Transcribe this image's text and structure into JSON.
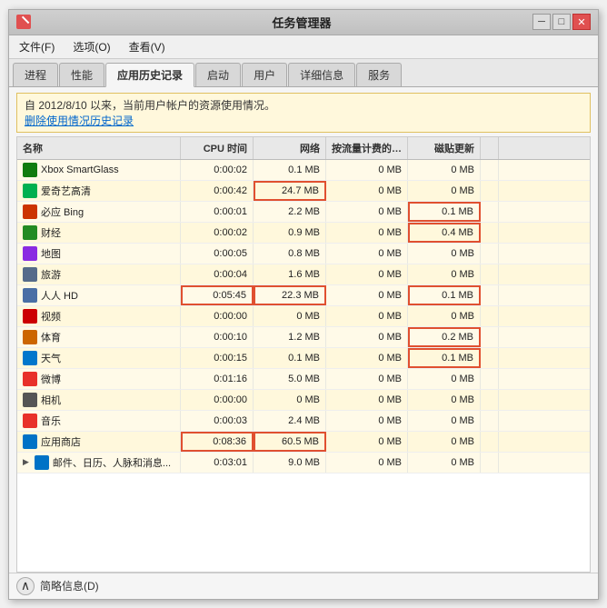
{
  "window": {
    "title": "任务管理器",
    "controls": {
      "minimize": "─",
      "maximize": "□",
      "close": "✕"
    }
  },
  "menu": {
    "items": [
      {
        "label": "文件(F)"
      },
      {
        "label": "选项(O)"
      },
      {
        "label": "查看(V)"
      }
    ]
  },
  "tabs": [
    {
      "label": "进程",
      "active": false
    },
    {
      "label": "性能",
      "active": false
    },
    {
      "label": "应用历史记录",
      "active": true
    },
    {
      "label": "启动",
      "active": false
    },
    {
      "label": "用户",
      "active": false
    },
    {
      "label": "详细信息",
      "active": false
    },
    {
      "label": "服务",
      "active": false
    }
  ],
  "info": {
    "text": "自 2012/8/10 以来，当前用户帐户的资源使用情况。",
    "link": "删除使用情况历史记录"
  },
  "table": {
    "headers": [
      "名称",
      "CPU 时间",
      "网络",
      "按流量计费的网...",
      "磁贴更新"
    ],
    "rows": [
      {
        "name": "Xbox SmartGlass",
        "cpu": "0:00:02",
        "network": "0.1 MB",
        "metered": "0 MB",
        "tile": "0 MB",
        "iconColor": "#107C10",
        "highlight_cpu": false,
        "highlight_net": false,
        "highlight_tile": false
      },
      {
        "name": "爱奇艺高清",
        "cpu": "0:00:42",
        "network": "24.7 MB",
        "metered": "0 MB",
        "tile": "0 MB",
        "iconColor": "#00b050",
        "highlight_cpu": false,
        "highlight_net": true,
        "highlight_tile": false
      },
      {
        "name": "必应 Bing",
        "cpu": "0:00:01",
        "network": "2.2 MB",
        "metered": "0 MB",
        "tile": "0.1 MB",
        "iconColor": "#cc3300",
        "highlight_cpu": false,
        "highlight_net": false,
        "highlight_tile": true
      },
      {
        "name": "财经",
        "cpu": "0:00:02",
        "network": "0.9 MB",
        "metered": "0 MB",
        "tile": "0.4 MB",
        "iconColor": "#228B22",
        "highlight_cpu": false,
        "highlight_net": false,
        "highlight_tile": true
      },
      {
        "name": "地图",
        "cpu": "0:00:05",
        "network": "0.8 MB",
        "metered": "0 MB",
        "tile": "0 MB",
        "iconColor": "#8a2be2",
        "highlight_cpu": false,
        "highlight_net": false,
        "highlight_tile": false
      },
      {
        "name": "旅游",
        "cpu": "0:00:04",
        "network": "1.6 MB",
        "metered": "0 MB",
        "tile": "0 MB",
        "iconColor": "#556b8a",
        "highlight_cpu": false,
        "highlight_net": false,
        "highlight_tile": false
      },
      {
        "name": "人人 HD",
        "cpu": "0:05:45",
        "network": "22.3 MB",
        "metered": "0 MB",
        "tile": "0.1 MB",
        "iconColor": "#4a6fa5",
        "highlight_cpu": true,
        "highlight_net": true,
        "highlight_tile": true
      },
      {
        "name": "视频",
        "cpu": "0:00:00",
        "network": "0 MB",
        "metered": "0 MB",
        "tile": "0 MB",
        "iconColor": "#cc0000",
        "highlight_cpu": false,
        "highlight_net": false,
        "highlight_tile": false
      },
      {
        "name": "体育",
        "cpu": "0:00:10",
        "network": "1.2 MB",
        "metered": "0 MB",
        "tile": "0.2 MB",
        "iconColor": "#cc6600",
        "highlight_cpu": false,
        "highlight_net": false,
        "highlight_tile": true
      },
      {
        "name": "天气",
        "cpu": "0:00:15",
        "network": "0.1 MB",
        "metered": "0 MB",
        "tile": "0.1 MB",
        "iconColor": "#0077cc",
        "highlight_cpu": false,
        "highlight_net": false,
        "highlight_tile": true
      },
      {
        "name": "微博",
        "cpu": "0:01:16",
        "network": "5.0 MB",
        "metered": "0 MB",
        "tile": "0 MB",
        "iconColor": "#e8312a",
        "highlight_cpu": false,
        "highlight_net": false,
        "highlight_tile": false
      },
      {
        "name": "相机",
        "cpu": "0:00:00",
        "network": "0 MB",
        "metered": "0 MB",
        "tile": "0 MB",
        "iconColor": "#555555",
        "highlight_cpu": false,
        "highlight_net": false,
        "highlight_tile": false
      },
      {
        "name": "音乐",
        "cpu": "0:00:03",
        "network": "2.4 MB",
        "metered": "0 MB",
        "tile": "0 MB",
        "iconColor": "#e8312a",
        "highlight_cpu": false,
        "highlight_net": false,
        "highlight_tile": false
      },
      {
        "name": "应用商店",
        "cpu": "0:08:36",
        "network": "60.5 MB",
        "metered": "0 MB",
        "tile": "0 MB",
        "iconColor": "#0072c6",
        "highlight_cpu": true,
        "highlight_net": true,
        "highlight_tile": false
      },
      {
        "name": "邮件、日历、人脉和消息...",
        "cpu": "0:03:01",
        "network": "9.0 MB",
        "metered": "0 MB",
        "tile": "0 MB",
        "iconColor": "#0072c6",
        "highlight_cpu": false,
        "highlight_net": false,
        "highlight_tile": false,
        "expandable": true
      }
    ]
  },
  "status": {
    "label": "简略信息(D)"
  }
}
